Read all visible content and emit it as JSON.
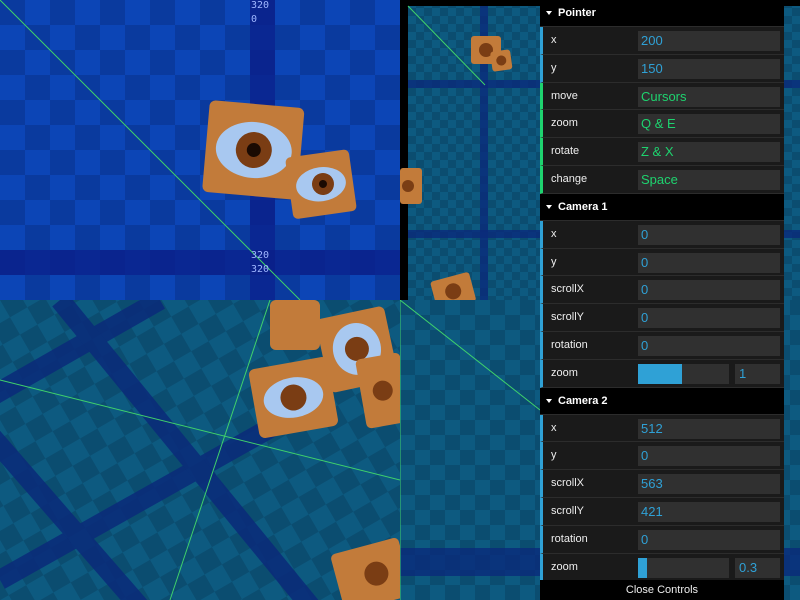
{
  "colors": {
    "number": "#2fa1d6",
    "string": "#1ed36f",
    "panel": "#1a1a1a",
    "field": "#303030"
  },
  "viewports": {
    "camera1": {
      "label_top": "320",
      "label_top2": "0",
      "label_bottom": "320",
      "label_bottom2": "320"
    }
  },
  "gui": {
    "folders": [
      {
        "title": "Pointer",
        "rows": [
          {
            "label": "x",
            "value": "200",
            "kind": "number"
          },
          {
            "label": "y",
            "value": "150",
            "kind": "number"
          },
          {
            "label": "move",
            "value": "Cursors",
            "kind": "string"
          },
          {
            "label": "zoom",
            "value": "Q & E",
            "kind": "string"
          },
          {
            "label": "rotate",
            "value": "Z & X",
            "kind": "string"
          },
          {
            "label": "change",
            "value": "Space",
            "kind": "string"
          }
        ]
      },
      {
        "title": "Camera 1",
        "rows": [
          {
            "label": "x",
            "value": "0",
            "kind": "number"
          },
          {
            "label": "y",
            "value": "0",
            "kind": "number"
          },
          {
            "label": "scrollX",
            "value": "0",
            "kind": "number"
          },
          {
            "label": "scrollY",
            "value": "0",
            "kind": "number"
          },
          {
            "label": "rotation",
            "value": "0",
            "kind": "number"
          },
          {
            "label": "zoom",
            "value": "1",
            "kind": "slider",
            "fraction": 0.48
          }
        ]
      },
      {
        "title": "Camera 2",
        "rows": [
          {
            "label": "x",
            "value": "512",
            "kind": "number"
          },
          {
            "label": "y",
            "value": "0",
            "kind": "number"
          },
          {
            "label": "scrollX",
            "value": "563",
            "kind": "number"
          },
          {
            "label": "scrollY",
            "value": "421",
            "kind": "number"
          },
          {
            "label": "rotation",
            "value": "0",
            "kind": "number"
          },
          {
            "label": "zoom",
            "value": "0.3",
            "kind": "slider",
            "fraction": 0.1
          }
        ]
      }
    ],
    "close_label": "Close Controls"
  }
}
